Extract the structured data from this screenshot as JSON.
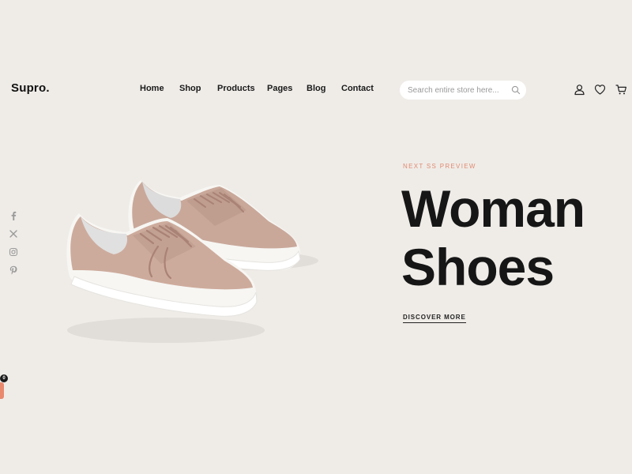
{
  "header": {
    "logo": "Supro.",
    "nav": [
      {
        "label": "Home"
      },
      {
        "label": "Shop"
      },
      {
        "label": "Products"
      },
      {
        "label": "Pages"
      },
      {
        "label": "Blog"
      },
      {
        "label": "Contact"
      }
    ],
    "search": {
      "placeholder": "Search entire store here...",
      "icon": "search-icon"
    },
    "icons": [
      "user-icon",
      "heart-icon",
      "cart-icon"
    ]
  },
  "social": [
    "facebook-icon",
    "x-icon",
    "instagram-icon",
    "pinterest-icon"
  ],
  "hero": {
    "eyebrow": "NEXT SS PREVIEW",
    "title_line1": "Woman",
    "title_line2": "Shoes",
    "cta": "DISCOVER MORE",
    "image": "pink-sneakers"
  },
  "cart_badge": "0",
  "colors": {
    "background": "#efece8",
    "accent": "#e08b72",
    "text": "#161616",
    "shoe": "#c9a89a"
  }
}
